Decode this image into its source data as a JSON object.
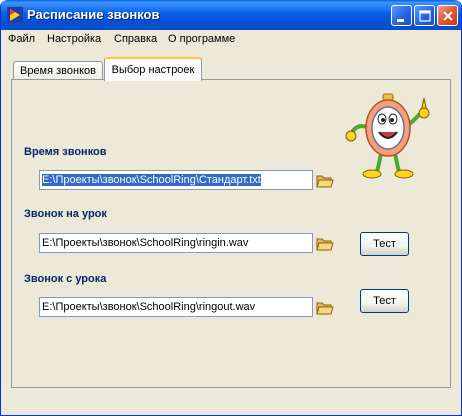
{
  "window": {
    "title": "Расписание звонков"
  },
  "menu": {
    "items": [
      "Файл",
      "Настройка",
      "Справка",
      "О программе"
    ]
  },
  "tabs": [
    {
      "label": "Время звонков",
      "active": false
    },
    {
      "label": "Выбор настроек",
      "active": true
    }
  ],
  "settings": {
    "schedule_label": "Время звонков",
    "schedule_path": "E:\\Проекты\\звонок\\SchoolRing\\Стандарт.txt",
    "ring_in_label": "Звонок на урок",
    "ring_in_path": "E:\\Проекты\\звонок\\SchoolRing\\ringin.wav",
    "ring_out_label": "Звонок с урока",
    "ring_out_path": "E:\\Проекты\\звонок\\SchoolRing\\ringout.wav",
    "test_label": "Тест"
  },
  "icons": {
    "folder": "open-folder-icon",
    "mascot": "clock-mascot-icon",
    "app": "app-icon"
  },
  "colors": {
    "titlebar": "#0a5fd8",
    "section_label": "#0a246a",
    "selection": "#316ac5",
    "window_bg": "#ece9d8"
  }
}
